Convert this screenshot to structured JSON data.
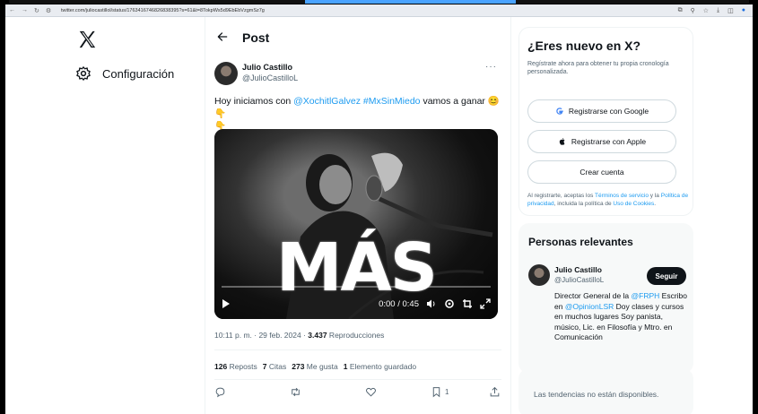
{
  "browser": {
    "url": "twitter.com/juliocastillol/status/1763416746826838395?s=61&t=8TokpWs5d9EbEbVzgmSz7g"
  },
  "sidebar": {
    "settings_label": "Configuración"
  },
  "post": {
    "header_title": "Post",
    "author_name": "Julio Castillo",
    "author_handle": "@JulioCastilloL",
    "more_label": "···",
    "text_before": "Hoy iniciamos con ",
    "mention": "@XochitlGalvez",
    "hashtag": "#MxSinMiedo",
    "text_after": " vamos a ganar 😊👇",
    "text_line2": "👇",
    "media": {
      "overlay_word": "MÁS",
      "time": "0:00 / 0:45"
    },
    "meta_time": "10:11 p. m. · 29 feb. 2024 · ",
    "meta_views": "3.437",
    "meta_views_label": " Reproducciones",
    "stats": {
      "reposts_count": "126",
      "reposts_label": "Reposts",
      "quotes_count": "7",
      "quotes_label": "Citas",
      "likes_count": "273",
      "likes_label": "Me gusta",
      "bookmarks_count": "1",
      "bookmarks_label": "Elemento guardado"
    },
    "actions": {
      "bookmark_count": "1"
    }
  },
  "signup": {
    "title": "¿Eres nuevo en X?",
    "description": "Regístrate ahora para obtener tu propia cronología personalizada.",
    "google_label": "Registrarse con Google",
    "apple_label": "Registrarse con Apple",
    "create_label": "Crear cuenta",
    "legal_1": "Al registrarte, aceptas los ",
    "legal_terms": "Términos de servicio",
    "legal_2": " y la ",
    "legal_privacy": "Política de privacidad",
    "legal_3": ", incluida la política de ",
    "legal_cookies": "Uso de Cookies",
    "legal_4": "."
  },
  "relevant": {
    "title": "Personas relevantes",
    "name": "Julio Castillo",
    "handle": "@JulioCastilloL",
    "follow_label": "Seguir",
    "bio_1": "Director General de la ",
    "bio_link1": "@FRPH",
    "bio_2": " Escribo en ",
    "bio_link2": "@OpinionLSR",
    "bio_3": " Doy clases y cursos en muchos lugares Soy panista, músico, Lic. en Filosofía y Mtro. en Comunicación"
  },
  "trends": {
    "text": "Las tendencias no están disponibles."
  },
  "colors": {
    "accent": "#1d9bf0",
    "text": "#0f1419",
    "muted": "#536471"
  }
}
